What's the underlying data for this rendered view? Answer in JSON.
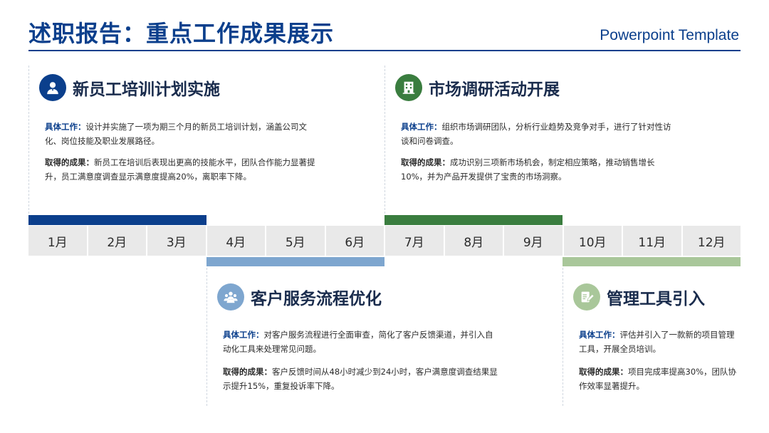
{
  "header": {
    "title": "述职报告：重点工作成果展示",
    "subtitle": "Powerpoint Template"
  },
  "colors": {
    "accent_blue": "#0b3f8c",
    "light_blue": "#7ea6cf",
    "green": "#3a7d3f",
    "light_green": "#a9c79a",
    "month_bg": "#e9e9e9"
  },
  "cards": [
    {
      "icon": "employee-icon",
      "title": "新员工培训计划实施",
      "work_label": "具体工作：",
      "work_text": "设计并实施了一项为期三个月的新员工培训计划，涵盖公司文化、岗位技能及职业发展路径。",
      "result_label": "取得的成果：",
      "result_text": "新员工在培训后表现出更高的技能水平，团队合作能力显著提升，员工满意度调查显示满意度提高20%，离职率下降。"
    },
    {
      "icon": "building-icon",
      "title": "市场调研活动开展",
      "work_label": "具体工作：",
      "work_text": "组织市场调研团队，分析行业趋势及竞争对手，进行了针对性访谈和问卷调查。",
      "result_label": "取得的成果：",
      "result_text": "成功识别三项新市场机会，制定相应策略，推动销售增长10%，并为产品开发提供了宝贵的市场洞察。"
    },
    {
      "icon": "team-icon",
      "title": "客户服务流程优化",
      "work_label": "具体工作：",
      "work_text": "对客户服务流程进行全面审查，简化了客户反馈渠道，并引入自动化工具来处理常见问题。",
      "result_label": "取得的成果：",
      "result_text": "客户反馈时间从48小时减少到24小时，客户满意度调查结果显示提升15%，重复投诉率下降。"
    },
    {
      "icon": "edit-icon",
      "title": "管理工具引入",
      "work_label": "具体工作：",
      "work_text": "评估并引入了一款新的项目管理工具，开展全员培训。",
      "result_label": "取得的成果：",
      "result_text": "项目完成率提高30%，团队协作效率显著提升。"
    }
  ],
  "months": [
    "1月",
    "2月",
    "3月",
    "4月",
    "5月",
    "6月",
    "7月",
    "8月",
    "9月",
    "10月",
    "11月",
    "12月"
  ]
}
